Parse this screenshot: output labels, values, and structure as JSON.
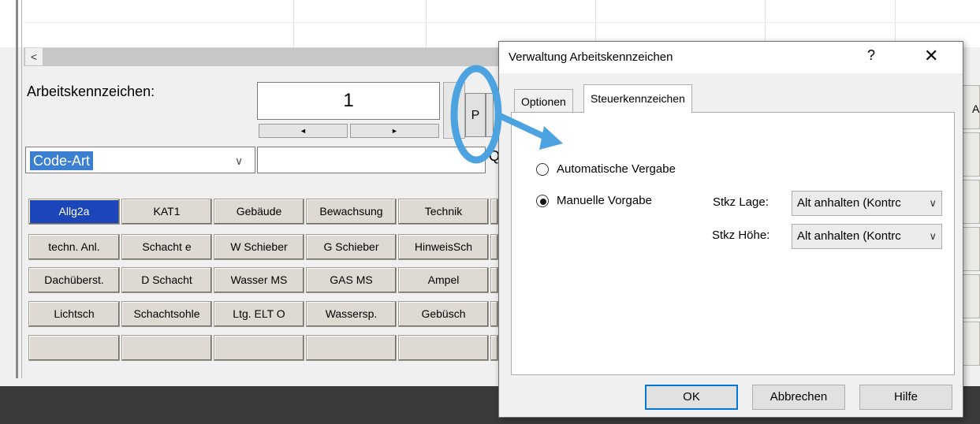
{
  "main": {
    "scroll_left_arrow": "<",
    "arbeitskennzeichen_label": "Arbeitskennzeichen:",
    "kennzeichen_value": "1",
    "spin_left": "◄",
    "spin_right": "►",
    "code_art_value": "Code-Art",
    "combo_arrow": "∨",
    "p_button": "P",
    "q_label": "Q",
    "buttons": [
      [
        "Allg2a",
        "KAT1",
        "Gebäude",
        "Bewachsung",
        "Technik"
      ],
      [
        "techn. Anl.",
        "Schacht e",
        "W Schieber",
        "G Schieber",
        "HinweisSch"
      ],
      [
        "Dachüberst.",
        "D Schacht",
        "Wasser MS",
        "GAS MS",
        "Ampel"
      ],
      [
        "Lichtsch",
        "Schachtsohle",
        "Ltg. ELT O",
        "Wassersp.",
        "Gebüsch"
      ],
      [
        "",
        "",
        "",
        "",
        ""
      ]
    ],
    "right_edge_letter": "A"
  },
  "dialog": {
    "title": "Verwaltung Arbeitskennzeichen",
    "help": "?",
    "close": "✕",
    "tabs": [
      "Optionen",
      "Steuerkennzeichen"
    ],
    "active_tab": "Steuerkennzeichen",
    "radio_auto": "Automatische Vergabe",
    "radio_manual": "Manuelle Vorgabe",
    "selected_radio": "Manuelle Vorgabe",
    "stkz_lage_label": "Stkz Lage:",
    "stkz_lage_value": "Alt anhalten (Kontrc",
    "stkz_hoehe_label": "Stkz Höhe:",
    "stkz_hoehe_value": "Alt anhalten (Kontrc",
    "select_arrow": "∨",
    "ok": "OK",
    "cancel": "Abbrechen",
    "help_button": "Hilfe"
  },
  "colors": {
    "selected_button": "#1b45b8",
    "annotation_blue": "#4da3e0"
  }
}
